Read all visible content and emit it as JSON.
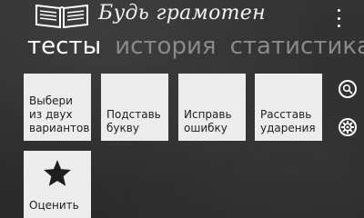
{
  "app": {
    "title": "Будь грамотен"
  },
  "pivot": {
    "items": [
      "тесты",
      "история",
      "статистика"
    ]
  },
  "tiles": [
    {
      "label": "Выбери\nиз двух\nвариантов"
    },
    {
      "label": "Подставь\nбукву"
    },
    {
      "label": "Исправь\nошибку"
    },
    {
      "label": "Расставь\nударения"
    },
    {
      "label": "Оценить",
      "icon": "star-icon"
    }
  ],
  "side_buttons": [
    {
      "icon": "search-icon"
    },
    {
      "icon": "gear-icon"
    }
  ],
  "colors": {
    "background": "#2e2e2e",
    "tile": "#ececec",
    "tile_text": "#1e1e1e",
    "inactive_pivot": "#8a8a8a"
  }
}
